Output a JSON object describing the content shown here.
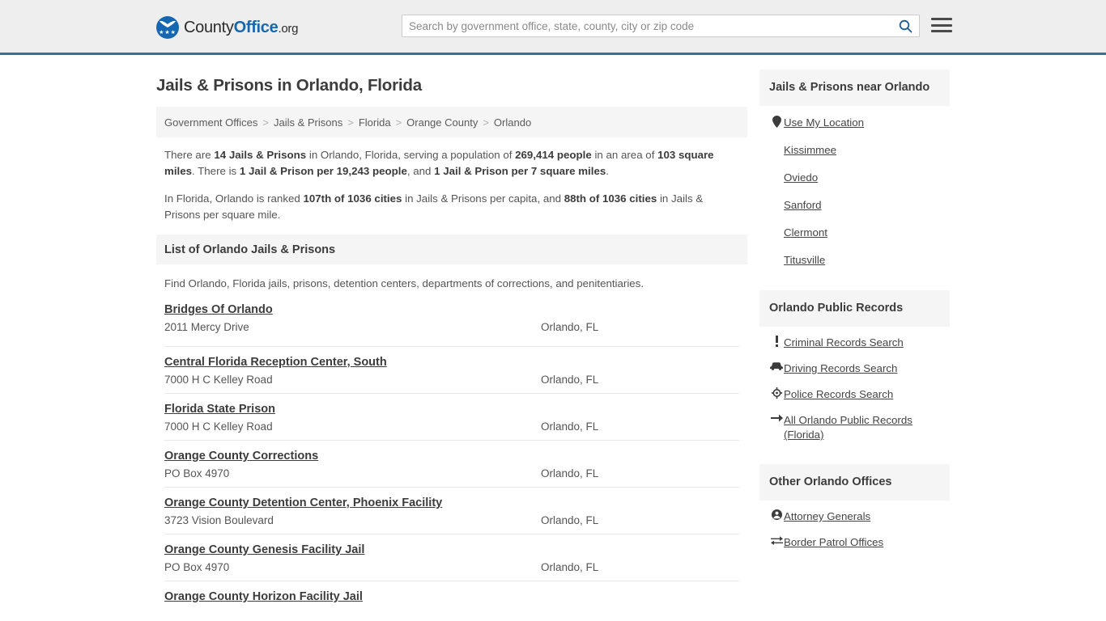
{
  "header": {
    "logo": {
      "part1": "County",
      "part2": "Office",
      "part3": ".org",
      "icon": "eagle-shield-logo"
    },
    "search": {
      "placeholder": "Search by government office, state, county, city or zip code",
      "value": "",
      "icon": "search-icon"
    },
    "menu_icon": "hamburger-menu-icon",
    "accent_color": "#3b6e96"
  },
  "page": {
    "title": "Jails & Prisons in Orlando, Florida"
  },
  "breadcrumb": {
    "separator": ">",
    "items": [
      {
        "label": "Government Offices"
      },
      {
        "label": "Jails & Prisons"
      },
      {
        "label": "Florida"
      },
      {
        "label": "Orange County"
      },
      {
        "label": "Orlando"
      }
    ]
  },
  "intro": {
    "p1": [
      {
        "t": "There are ",
        "b": false
      },
      {
        "t": "14 Jails & Prisons",
        "b": true
      },
      {
        "t": " in Orlando, Florida, serving a population of ",
        "b": false
      },
      {
        "t": "269,414 people",
        "b": true
      },
      {
        "t": " in an area of ",
        "b": false
      },
      {
        "t": "103 square miles",
        "b": true
      },
      {
        "t": ". There is ",
        "b": false
      },
      {
        "t": "1 Jail & Prison per 19,243 people",
        "b": true
      },
      {
        "t": ", and ",
        "b": false
      },
      {
        "t": "1 Jail & Prison per 7 square miles",
        "b": true
      },
      {
        "t": ".",
        "b": false
      }
    ],
    "p2": [
      {
        "t": "In Florida, Orlando is ranked ",
        "b": false
      },
      {
        "t": "107th of 1036 cities",
        "b": true
      },
      {
        "t": " in Jails & Prisons per capita, and ",
        "b": false
      },
      {
        "t": "88th of 1036 cities",
        "b": true
      },
      {
        "t": " in Jails & Prisons per square mile.",
        "b": false
      }
    ]
  },
  "list_section": {
    "heading": "List of Orlando Jails & Prisons",
    "description": "Find Orlando, Florida jails, prisons, detention centers, departments of corrections, and penitentiaries.",
    "rows": [
      {
        "name": "Bridges Of Orlando",
        "address": "2011 Mercy Drive",
        "city": "Orlando, FL"
      },
      {
        "name": "Central Florida Reception Center, South",
        "address": "7000 H C Kelley Road",
        "city": "Orlando, FL"
      },
      {
        "name": "Florida State Prison",
        "address": "7000 H C Kelley Road",
        "city": "Orlando, FL"
      },
      {
        "name": "Orange County Corrections",
        "address": "PO Box 4970",
        "city": "Orlando, FL"
      },
      {
        "name": "Orange County Detention Center, Phoenix Facility",
        "address": "3723 Vision Boulevard",
        "city": "Orlando, FL"
      },
      {
        "name": "Orange County Genesis Facility Jail",
        "address": "PO Box 4970",
        "city": "Orlando, FL"
      },
      {
        "name": "Orange County Horizon Facility Jail",
        "address": "",
        "city": ""
      }
    ]
  },
  "sidebar": {
    "nearby": {
      "heading": "Jails & Prisons near Orlando",
      "items": [
        {
          "label": "Use My Location",
          "icon": "map-pin-icon",
          "glyph": "•"
        },
        {
          "label": "Kissimmee",
          "icon": "",
          "glyph": ""
        },
        {
          "label": "Oviedo",
          "icon": "",
          "glyph": ""
        },
        {
          "label": "Sanford",
          "icon": "",
          "glyph": ""
        },
        {
          "label": "Clermont",
          "icon": "",
          "glyph": ""
        },
        {
          "label": "Titusville",
          "icon": "",
          "glyph": ""
        }
      ]
    },
    "public_records": {
      "heading": "Orlando Public Records",
      "items": [
        {
          "label": "Criminal Records Search",
          "icon": "exclamation-icon",
          "glyph": "!"
        },
        {
          "label": "Driving Records Search",
          "icon": "car-icon",
          "glyph": "▬"
        },
        {
          "label": "Police Records Search",
          "icon": "police-badge-icon",
          "glyph": "⊕"
        },
        {
          "label": "All Orlando Public Records (Florida)",
          "icon": "arrow-right-icon",
          "glyph": "→"
        }
      ]
    },
    "other_offices": {
      "heading": "Other Orlando Offices",
      "items": [
        {
          "label": "Attorney Generals",
          "icon": "user-circle-icon",
          "glyph": "●"
        },
        {
          "label": "Border Patrol Offices",
          "icon": "exchange-arrows-icon",
          "glyph": "⇄"
        }
      ]
    }
  }
}
